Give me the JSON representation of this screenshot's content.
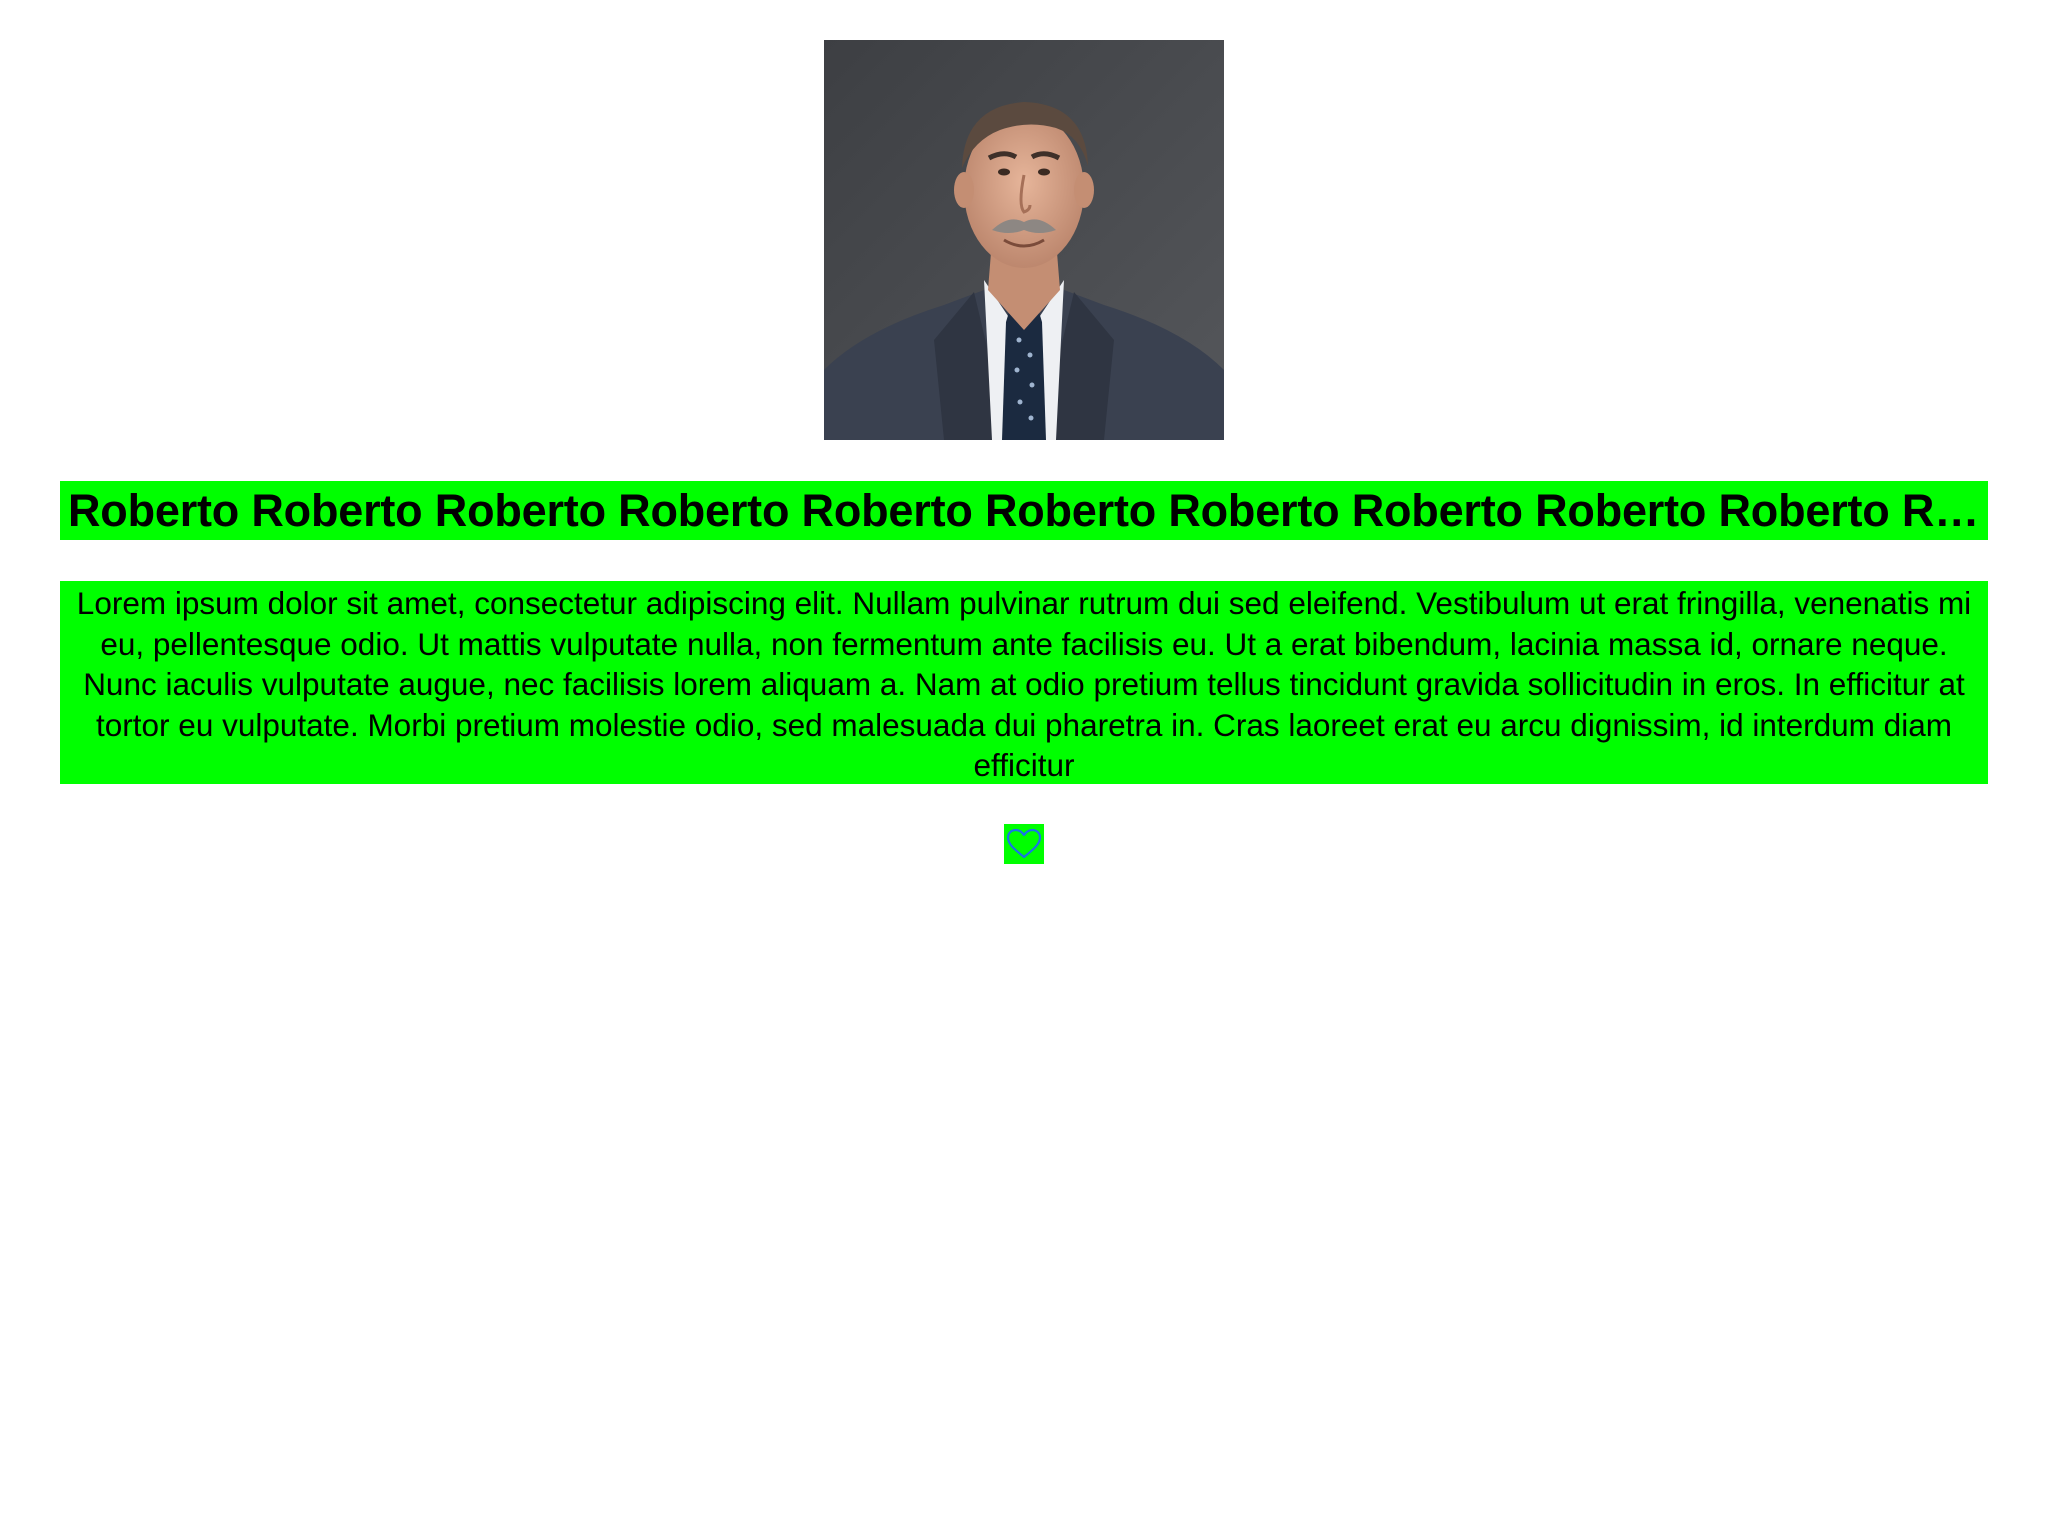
{
  "profile": {
    "photo_icon": "person-portrait-photo",
    "name": "Roberto Roberto Roberto Roberto Roberto Roberto Roberto Roberto Roberto Roberto Roberto Roberto",
    "description": "Lorem ipsum dolor sit amet, consectetur adipiscing elit. Nullam pulvinar rutrum dui sed eleifend. Vestibulum ut erat fringilla, venenatis mi eu, pellentesque odio. Ut mattis vulputate nulla, non fermentum ante facilisis eu. Ut a erat bibendum, lacinia massa id, ornare neque. Nunc iaculis vulputate augue, nec facilisis lorem aliquam a. Nam at odio pretium tellus tincidunt gravida sollicitudin in eros. In efficitur at tortor eu vulputate. Morbi pretium molestie odio, sed malesuada dui pharetra in. Cras laoreet erat eu arcu dignissim, id interdum diam efficitur",
    "favorite_icon": "heart-outline-icon"
  },
  "colors": {
    "highlight": "#00ff00",
    "heart_stroke": "#1a73e8",
    "background": "#ffffff"
  }
}
